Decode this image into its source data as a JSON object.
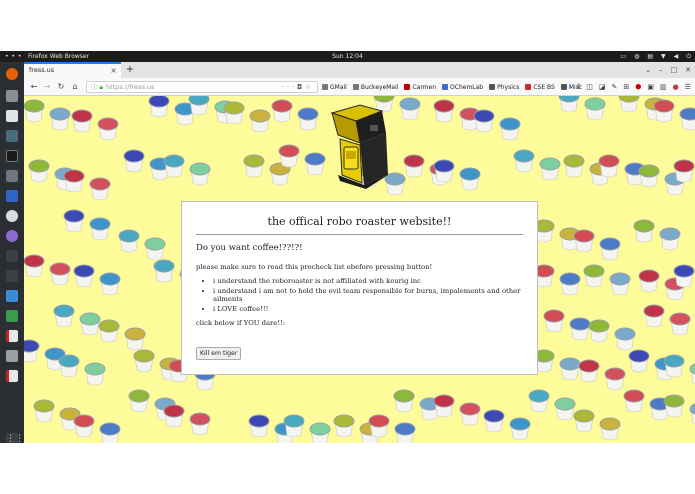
{
  "system": {
    "app_name": "Firefox Web Browser",
    "clock": "Sun 12:04"
  },
  "browser": {
    "tab_title": "fress.us",
    "url": "https://fress.us",
    "bookmarks": [
      {
        "label": "GMail",
        "icon": "globe-icon",
        "color": "#777777"
      },
      {
        "label": "BuckeyeMail",
        "icon": "globe-icon",
        "color": "#777777"
      },
      {
        "label": "Carmen",
        "icon": "carmen-icon",
        "color": "#bb0000"
      },
      {
        "label": "OChemLab",
        "icon": "puzzle-icon",
        "color": "#3d6bd8"
      },
      {
        "label": "Physics",
        "icon": "flask-icon",
        "color": "#555555"
      },
      {
        "label": "CSE BS",
        "icon": "wolfram-icon",
        "color": "#d12a2a"
      },
      {
        "label": "Misc",
        "icon": "folder-icon",
        "color": "#555555"
      }
    ]
  },
  "page": {
    "background_color": "#fefc9a",
    "dialog": {
      "title": "the offical robo roaster website!!",
      "question": "Do you want coffee!??!?!",
      "note": "please make sure to read this precheck list ebefore pressing button!",
      "checklist": [
        "i understand the roboroaster is not affiliated with keurig inc",
        "i understand i am not to hold the evil team responsible for burns, impalements and other ailments",
        "i LOVE coffee!!!"
      ],
      "dare_text": "click below if YOU dare!!:",
      "button_label": "Kill em tiger"
    }
  }
}
